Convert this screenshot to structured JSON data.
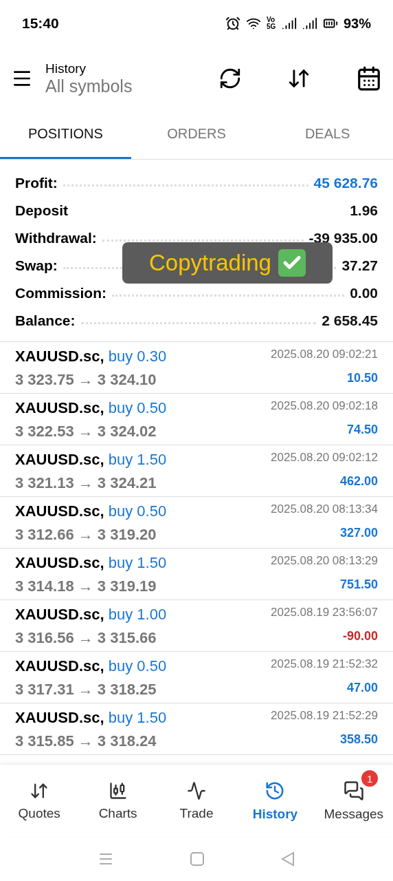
{
  "status_bar": {
    "time": "15:40",
    "battery": "93%",
    "network": "Vo 5G"
  },
  "header": {
    "title": "History",
    "subtitle": "All symbols"
  },
  "tabs": [
    {
      "label": "POSITIONS",
      "selected": true
    },
    {
      "label": "ORDERS",
      "selected": false
    },
    {
      "label": "DEALS",
      "selected": false
    }
  ],
  "summary": [
    {
      "label": "Profit:",
      "value": "45 628.76",
      "kind": "accent",
      "dotted": true
    },
    {
      "label": "Deposit",
      "value": "1.96",
      "kind": "plain",
      "dotted": false
    },
    {
      "label": "Withdrawal:",
      "value": "-39 935.00",
      "kind": "plain",
      "dotted": true
    },
    {
      "label": "Swap:",
      "value": "37.27",
      "kind": "plain",
      "dotted": true
    },
    {
      "label": "Commission:",
      "value": "0.00",
      "kind": "plain",
      "dotted": true
    },
    {
      "label": "Balance:",
      "value": "2 658.45",
      "kind": "plain",
      "dotted": true
    }
  ],
  "overlay": {
    "text": "Copytrading"
  },
  "deals": [
    {
      "symbol": "XAUUSD.sc,",
      "side": "buy 0.30",
      "prices": "3 323.75 → 3 324.10",
      "time": "2025.08.20 09:02:21",
      "profit": "10.50",
      "color": "#1976d2"
    },
    {
      "symbol": "XAUUSD.sc,",
      "side": "buy 0.50",
      "prices": "3 322.53 → 3 324.02",
      "time": "2025.08.20 09:02:18",
      "profit": "74.50",
      "color": "#1976d2"
    },
    {
      "symbol": "XAUUSD.sc,",
      "side": "buy 1.50",
      "prices": "3 321.13 → 3 324.21",
      "time": "2025.08.20 09:02:12",
      "profit": "462.00",
      "color": "#1976d2"
    },
    {
      "symbol": "XAUUSD.sc,",
      "side": "buy 0.50",
      "prices": "3 312.66 → 3 319.20",
      "time": "2025.08.20 08:13:34",
      "profit": "327.00",
      "color": "#1976d2"
    },
    {
      "symbol": "XAUUSD.sc,",
      "side": "buy 1.50",
      "prices": "3 314.18 → 3 319.19",
      "time": "2025.08.20 08:13:29",
      "profit": "751.50",
      "color": "#1976d2"
    },
    {
      "symbol": "XAUUSD.sc,",
      "side": "buy 1.00",
      "prices": "3 316.56 → 3 315.66",
      "time": "2025.08.19 23:56:07",
      "profit": "-90.00",
      "color": "#c62828"
    },
    {
      "symbol": "XAUUSD.sc,",
      "side": "buy 0.50",
      "prices": "3 317.31 → 3 318.25",
      "time": "2025.08.19 21:52:32",
      "profit": "47.00",
      "color": "#1976d2"
    },
    {
      "symbol": "XAUUSD.sc,",
      "side": "buy 1.50",
      "prices": "3 315.85 → 3 318.24",
      "time": "2025.08.19 21:52:29",
      "profit": "358.50",
      "color": "#1976d2"
    }
  ],
  "nav": [
    {
      "label": "Quotes",
      "kind": "quotes",
      "selected": false
    },
    {
      "label": "Charts",
      "kind": "charts",
      "selected": false
    },
    {
      "label": "Trade",
      "kind": "trade",
      "selected": false
    },
    {
      "label": "History",
      "kind": "history",
      "selected": true
    },
    {
      "label": "Messages",
      "kind": "messages",
      "selected": false,
      "badge": "1"
    }
  ]
}
